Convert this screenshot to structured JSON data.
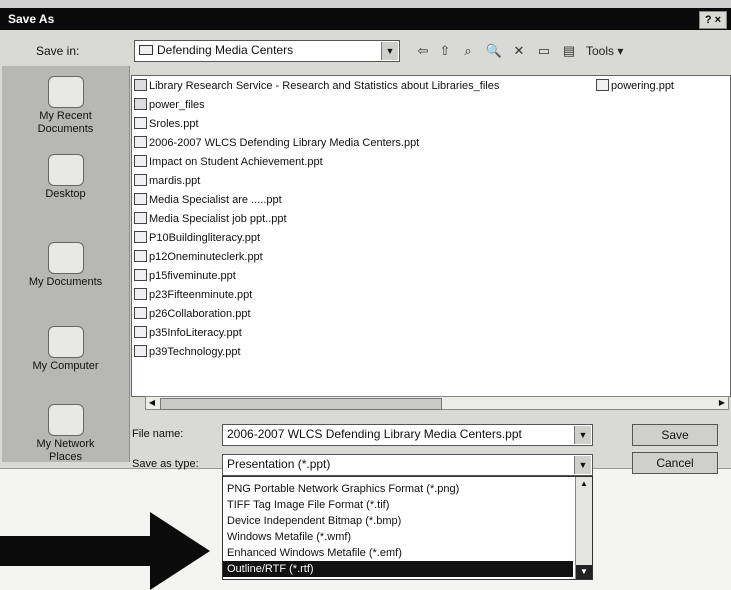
{
  "dialog": {
    "title": "Save As",
    "help_label": "? ×"
  },
  "toolbar": {
    "save_in_label": "Save in:",
    "save_in_value": "Defending Media Centers",
    "tools_label": "Tools ▾"
  },
  "places": [
    {
      "label1": "My Recent",
      "label2": "Documents",
      "icon": "recent-documents-icon"
    },
    {
      "label1": "Desktop",
      "label2": "",
      "icon": "desktop-icon"
    },
    {
      "label1": "My Documents",
      "label2": "",
      "icon": "my-documents-icon"
    },
    {
      "label1": "My Computer",
      "label2": "",
      "icon": "my-computer-icon"
    },
    {
      "label1": "My Network",
      "label2": "Places",
      "icon": "network-places-icon"
    }
  ],
  "files": [
    {
      "name": "Library Research Service - Research and Statistics about Libraries_files",
      "type": "folder"
    },
    {
      "name": "powering.ppt",
      "type": "ppt"
    },
    {
      "name": "power_files",
      "type": "folder"
    },
    {
      "name": "Sroles.ppt",
      "type": "ppt"
    },
    {
      "name": "2006-2007 WLCS Defending Library Media Centers.ppt",
      "type": "ppt"
    },
    {
      "name": "Impact on Student Achievement.ppt",
      "type": "ppt"
    },
    {
      "name": "mardis.ppt",
      "type": "ppt"
    },
    {
      "name": "Media Specialist are .....ppt",
      "type": "ppt"
    },
    {
      "name": "Media Specialist job ppt..ppt",
      "type": "ppt"
    },
    {
      "name": "P10Buildingliteracy.ppt",
      "type": "ppt"
    },
    {
      "name": "p12Oneminuteclerk.ppt",
      "type": "ppt"
    },
    {
      "name": "p15fiveminute.ppt",
      "type": "ppt"
    },
    {
      "name": "p23Fifteenminute.ppt",
      "type": "ppt"
    },
    {
      "name": "p26Collaboration.ppt",
      "type": "ppt"
    },
    {
      "name": "p35InfoLiteracy.ppt",
      "type": "ppt"
    },
    {
      "name": "p39Technology.ppt",
      "type": "ppt"
    }
  ],
  "form": {
    "file_name_label": "File name:",
    "file_name_value": "2006-2007 WLCS Defending Library Media Centers.ppt",
    "save_as_type_label": "Save as type:",
    "save_as_type_value": "Presentation (*.ppt)",
    "save_label": "Save",
    "cancel_label": "Cancel"
  },
  "type_options": [
    "PNG Portable Network Graphics Format (*.png)",
    "TIFF Tag Image File Format (*.tif)",
    "Device Independent Bitmap (*.bmp)",
    "Windows Metafile (*.wmf)",
    "Enhanced Windows Metafile (*.emf)",
    "Outline/RTF (*.rtf)"
  ],
  "selected_option_index": 5
}
